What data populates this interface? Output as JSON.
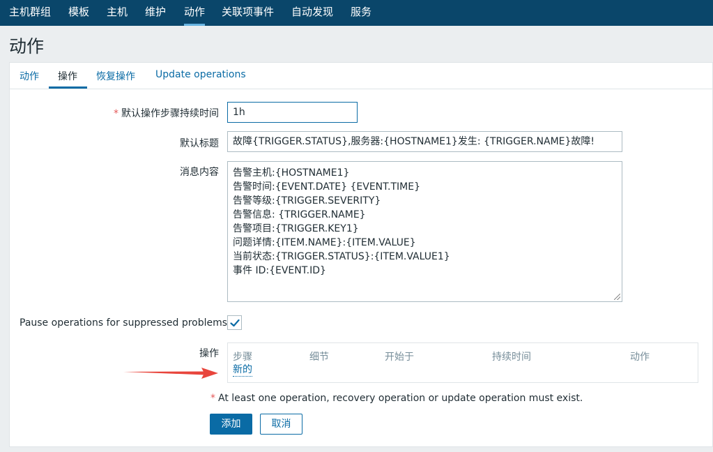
{
  "topnav": {
    "items": [
      {
        "label": "主机群组"
      },
      {
        "label": "模板"
      },
      {
        "label": "主机"
      },
      {
        "label": "维护"
      },
      {
        "label": "动作",
        "active": true
      },
      {
        "label": "关联项事件"
      },
      {
        "label": "自动发现"
      },
      {
        "label": "服务"
      }
    ]
  },
  "page": {
    "title": "动作"
  },
  "tabs": [
    {
      "label": "动作"
    },
    {
      "label": "操作",
      "active": true
    },
    {
      "label": "恢复操作"
    },
    {
      "label": "Update operations"
    }
  ],
  "form": {
    "duration": {
      "label": "默认操作步骤持续时间",
      "required_mark": "*",
      "value": "1h"
    },
    "subject": {
      "label": "默认标题",
      "value": "故障{TRIGGER.STATUS},服务器:{HOSTNAME1}发生: {TRIGGER.NAME}故障!"
    },
    "message": {
      "label": "消息内容",
      "lines": [
        "告警主机:{HOSTNAME1}",
        "告警时间:{EVENT.DATE} {EVENT.TIME}",
        "告警等级:{TRIGGER.SEVERITY}",
        "告警信息: {TRIGGER.NAME}",
        "告警项目:{TRIGGER.KEY1}",
        "问题详情:{ITEM.NAME}:{ITEM.VALUE}",
        "当前状态:{TRIGGER.STATUS}:{ITEM.VALUE1}",
        "事件 ID:{EVENT.ID}"
      ]
    },
    "pause": {
      "label": "Pause operations for suppressed problems",
      "checked": true
    },
    "operations": {
      "label": "操作",
      "columns": [
        "步骤",
        "细节",
        "开始于",
        "持续时间",
        "动作"
      ],
      "new_link": "新的"
    },
    "warning": {
      "star": "*",
      "text": "At least one operation, recovery operation or update operation must exist."
    },
    "buttons": {
      "add": "添加",
      "cancel": "取消"
    }
  },
  "colors": {
    "nav_bg": "#0a466a",
    "accent": "#0a6ba5",
    "required": "#e45959",
    "arrow": "#e8453c"
  }
}
